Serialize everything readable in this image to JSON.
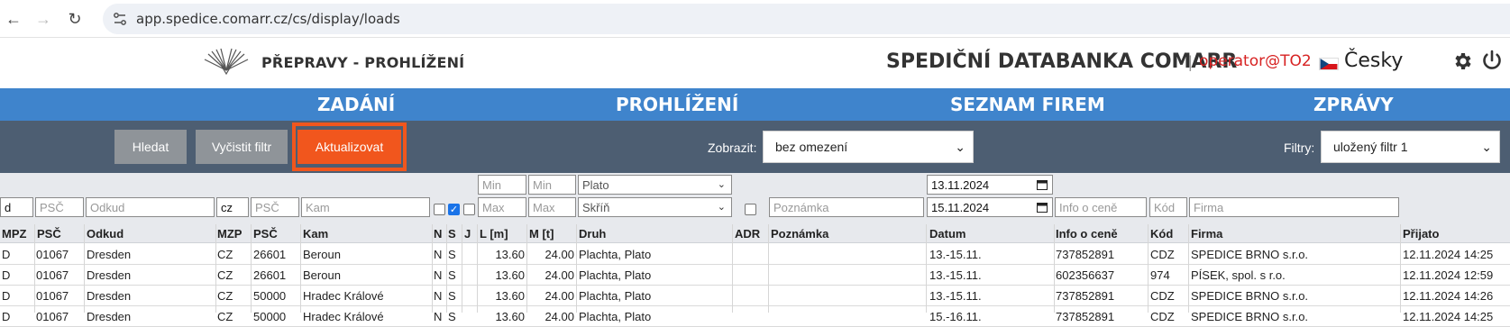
{
  "browser": {
    "url": "app.spedice.comarr.cz/cs/display/loads"
  },
  "header": {
    "page_title": "PŘEPRAVY - PROHLÍŽENÍ",
    "brand": "SPEDIČNÍ DATABANKA COMARR",
    "separator": "|",
    "user": "operator@TO2",
    "language": "Česky"
  },
  "nav": {
    "items": [
      "ZADÁNÍ",
      "PROHLÍŽENÍ",
      "SEZNAM FIREM",
      "ZPRÁVY"
    ]
  },
  "toolbar": {
    "search_label": "Hledat",
    "clear_label": "Vyčistit filtr",
    "refresh_label": "Aktualizovat",
    "show_label": "Zobrazit:",
    "show_value": "bez omezení",
    "filters_label": "Filtry:",
    "filters_value": "uložený filtr 1"
  },
  "filters": {
    "mpz_from": "d",
    "psc_from_placeholder": "PSČ",
    "odkud_placeholder": "Odkud",
    "mpz_to": "cz",
    "psc_to_placeholder": "PSČ",
    "kam_placeholder": "Kam",
    "l_min_placeholder": "Min",
    "l_max_placeholder": "Max",
    "m_min_placeholder": "Min",
    "m_max_placeholder": "Max",
    "druh_top": "Plato",
    "druh_bottom": "Skříň",
    "poznamka_placeholder": "Poznámka",
    "date_from": "13.11.2024",
    "date_to": "15.11.2024",
    "info_placeholder": "Info o ceně",
    "kod_placeholder": "Kód",
    "firma_placeholder": "Firma"
  },
  "table": {
    "headers": [
      "MPZ",
      "PSČ",
      "Odkud",
      "MZP",
      "PSČ",
      "Kam",
      "N",
      "S",
      "J",
      "L [m]",
      "M [t]",
      "Druh",
      "ADR",
      "Poznámka",
      "Datum",
      "Info o ceně",
      "Kód",
      "Firma",
      "Přijato"
    ],
    "rows": [
      {
        "mpz": "D",
        "psc": "01067",
        "odkud": "Dresden",
        "mzp": "CZ",
        "psc2": "26601",
        "kam": "Beroun",
        "n": "N",
        "s": "S",
        "l": "13.60",
        "m": "24.00",
        "druh": "Plachta, Plato",
        "adr": "",
        "poznamka": "",
        "datum": "13.-15.11.",
        "info": "737852891",
        "kod": "CDZ",
        "firma": "SPEDICE BRNO s.r.o.",
        "prijato": "12.11.2024 14:25"
      },
      {
        "mpz": "D",
        "psc": "01067",
        "odkud": "Dresden",
        "mzp": "CZ",
        "psc2": "26601",
        "kam": "Beroun",
        "n": "N",
        "s": "S",
        "l": "13.60",
        "m": "24.00",
        "druh": "Plachta, Plato",
        "adr": "",
        "poznamka": "",
        "datum": "13.-15.11.",
        "info": "602356637",
        "kod": "974",
        "firma": "PÍSEK, spol. s r.o.",
        "prijato": "12.11.2024 12:59"
      },
      {
        "mpz": "D",
        "psc": "01067",
        "odkud": "Dresden",
        "mzp": "CZ",
        "psc2": "50000",
        "kam": "Hradec Králové",
        "n": "N",
        "s": "S",
        "l": "13.60",
        "m": "24.00",
        "druh": "Plachta, Plato",
        "adr": "",
        "poznamka": "",
        "datum": "13.-15.11.",
        "info": "737852891",
        "kod": "CDZ",
        "firma": "SPEDICE BRNO s.r.o.",
        "prijato": "12.11.2024 14:26"
      },
      {
        "mpz": "D",
        "psc": "01067",
        "odkud": "Dresden",
        "mzp": "CZ",
        "psc2": "50000",
        "kam": "Hradec Králové",
        "n": "N",
        "s": "S",
        "l": "13.60",
        "m": "24.00",
        "druh": "Plachta, Plato",
        "adr": "",
        "poznamka": "",
        "datum": "15.-16.11.",
        "info": "737852891",
        "kod": "CDZ",
        "firma": "SPEDICE BRNO s.r.o.",
        "prijato": "12.11.2024 14:25"
      }
    ]
  }
}
